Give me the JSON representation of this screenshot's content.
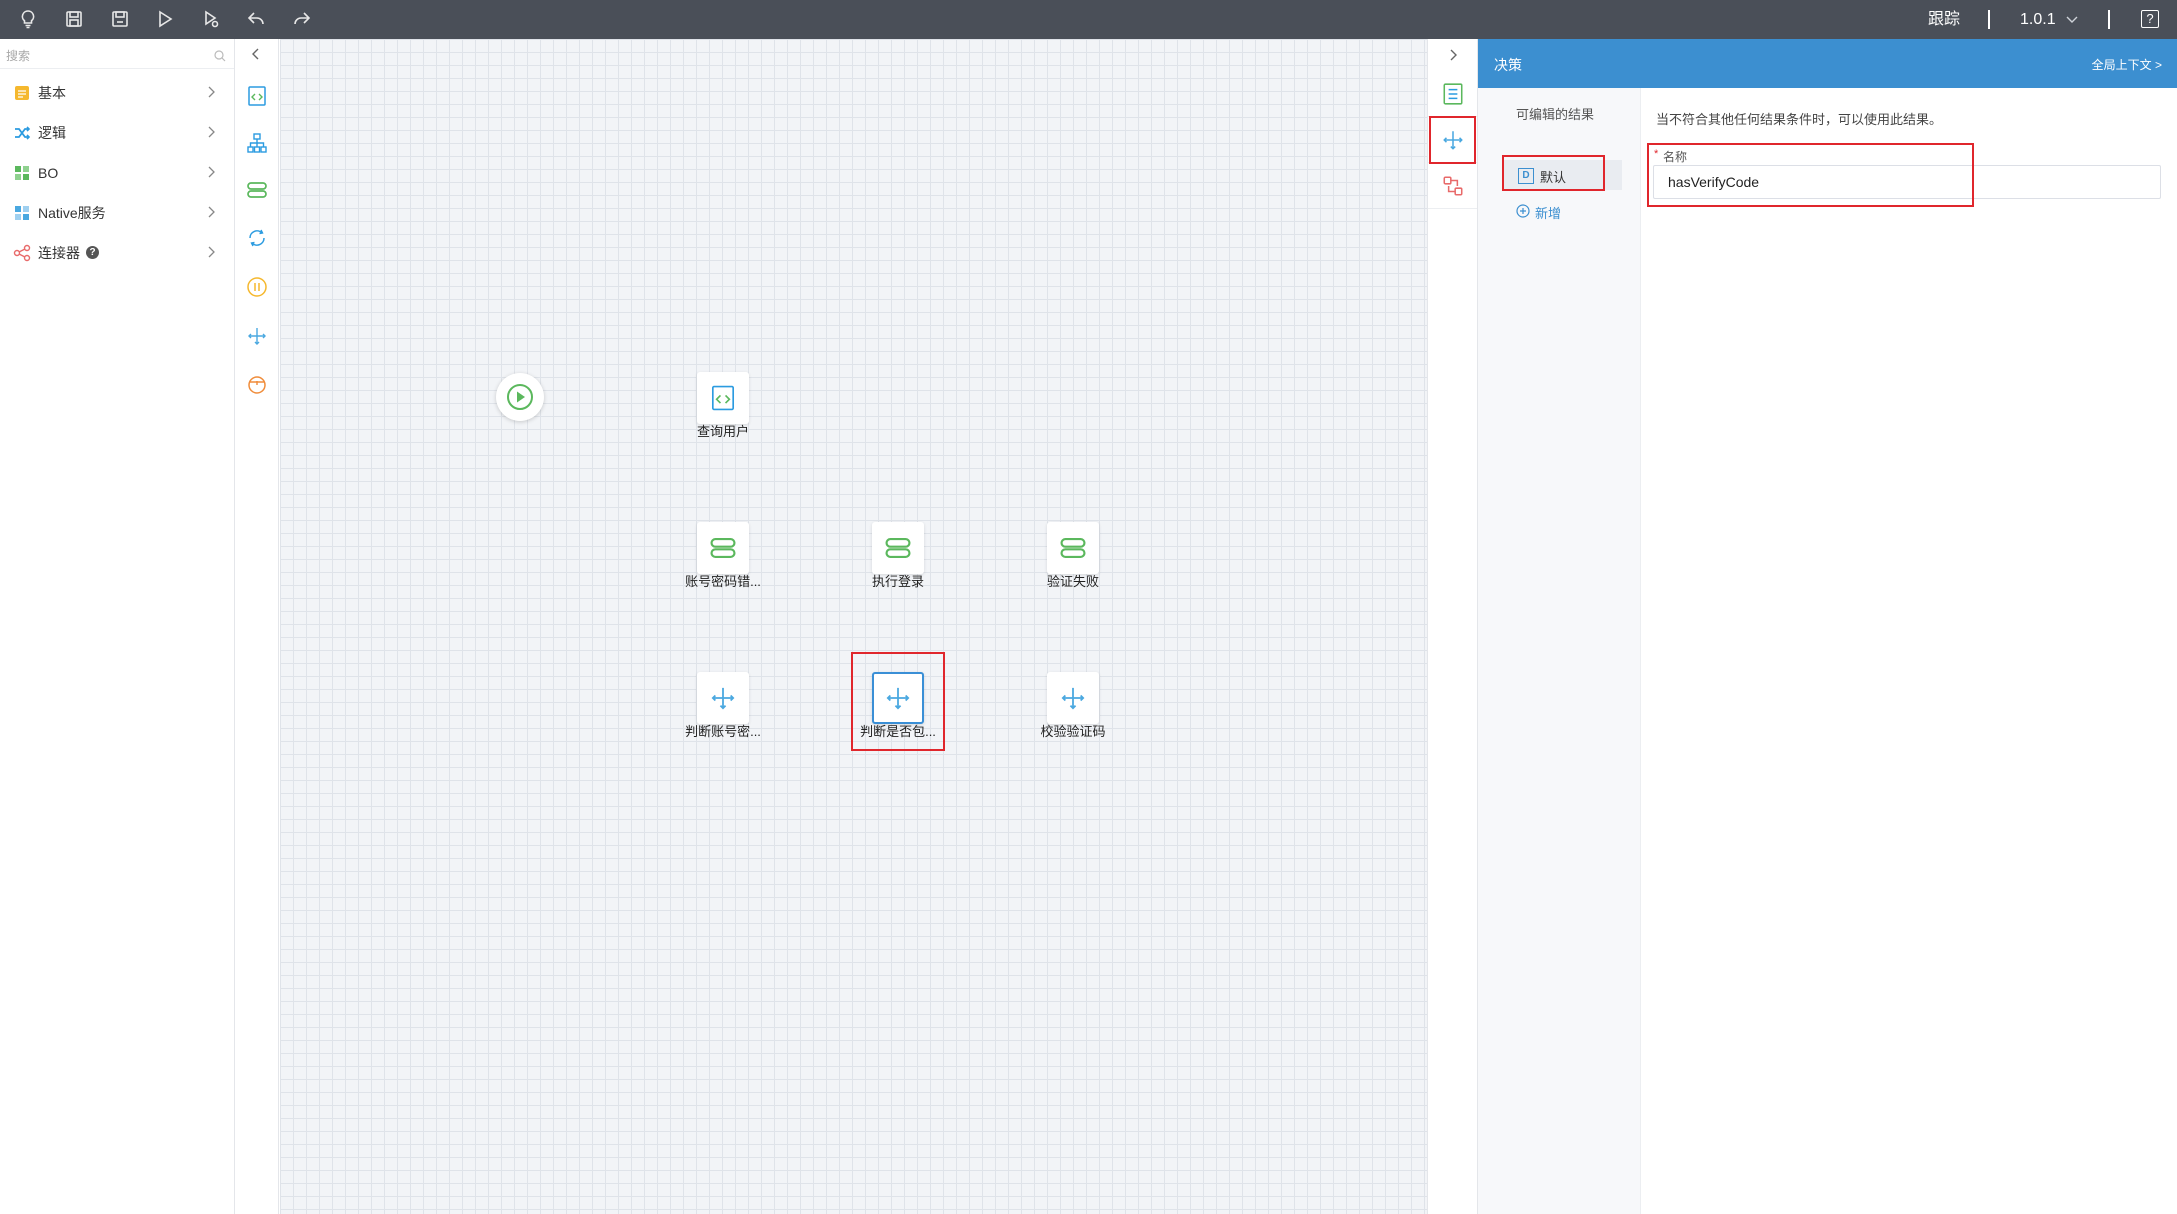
{
  "toolbar": {
    "buttons": [
      "bulb-icon",
      "save-icon",
      "save-as-icon",
      "run-icon",
      "debug-icon",
      "undo-icon",
      "redo-icon"
    ],
    "trace_label": "跟踪",
    "version": "1.0.1",
    "help_label": "?"
  },
  "left_panel": {
    "search_placeholder": "搜索",
    "categories": [
      {
        "label": "基本",
        "icon": "basic-icon",
        "color": "#f5b82e"
      },
      {
        "label": "逻辑",
        "icon": "shuffle-icon",
        "color": "#2b9be0"
      },
      {
        "label": "BO",
        "icon": "bo-icon",
        "color": "#5bb85d"
      },
      {
        "label": "Native服务",
        "icon": "native-service-icon",
        "color": "#4aa8e0"
      },
      {
        "label": "连接器",
        "icon": "connector-icon",
        "color": "#e86a6a"
      }
    ],
    "connector_help": "?"
  },
  "icon_strip": [
    "code-icon",
    "tree-icon",
    "data-icon",
    "loop-icon",
    "pause-icon",
    "decision-icon",
    "timer-icon"
  ],
  "canvas": {
    "nodes": [
      {
        "label": "查询用户",
        "icon": "code-icon"
      },
      {
        "label": "账号密码错...",
        "icon": "data-icon"
      },
      {
        "label": "执行登录",
        "icon": "data-icon"
      },
      {
        "label": "验证失败",
        "icon": "data-icon"
      },
      {
        "label": "判断账号密...",
        "icon": "decision-icon"
      },
      {
        "label": "判断是否包...",
        "icon": "decision-icon",
        "selected": true
      },
      {
        "label": "校验验证码",
        "icon": "decision-icon"
      }
    ]
  },
  "right_tabs": [
    "list-icon",
    "decision-tab-icon",
    "mapping-icon"
  ],
  "properties": {
    "title": "决策",
    "global_context": "全局上下文 >",
    "outcomes_title": "可编辑的结果",
    "default_outcome": "默认",
    "default_badge": "D",
    "add_label": "新增",
    "description": "当不符合其他任何结果条件时，可以使用此结果。",
    "required_mark": "*",
    "name_label": "名称",
    "name_value": "hasVerifyCode"
  },
  "colors": {
    "toolbar_bg": "#4a4f58",
    "header_blue": "#3c8fd0",
    "highlight_red": "#e0262c",
    "node_green": "#5bb85d",
    "node_blue": "#3a8fd6"
  }
}
